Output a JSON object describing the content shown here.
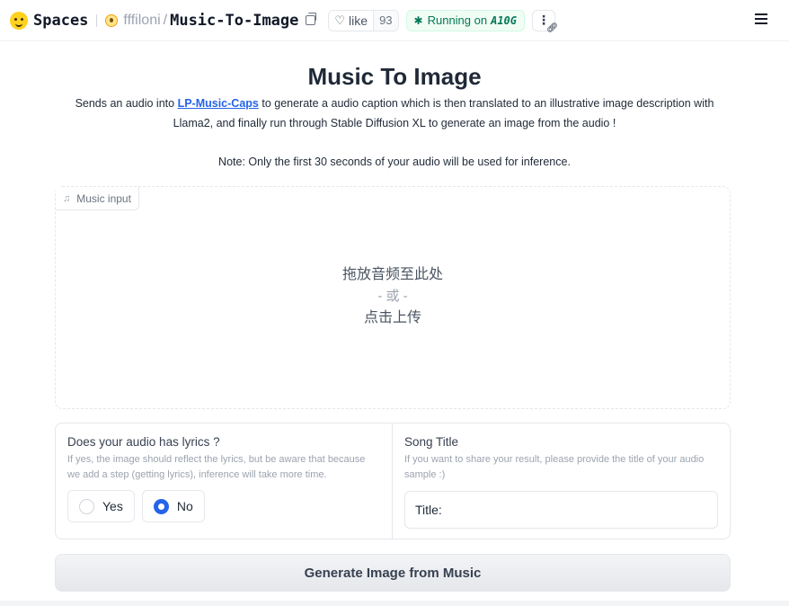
{
  "header": {
    "spaces_label": "Spaces",
    "owner": "fffiloni",
    "slash": "/",
    "repo": "Music-To-Image",
    "like_label": "like",
    "like_count": "93",
    "status_prefix": "Running on",
    "status_hardware": "A10G",
    "more_label": "⋮",
    "icons": {
      "logo": "hugging-face-logo",
      "copy": "copy-icon",
      "heart": "heart-icon",
      "status": "fan-icon",
      "link": "link-icon",
      "menu": "hamburger-menu-icon"
    },
    "colors": {
      "status_text": "#047857",
      "status_bg": "#f0fdf4"
    }
  },
  "main": {
    "title": "Music To Image",
    "desc_prefix": "Sends an audio into",
    "desc_link": "LP-Music-Caps",
    "desc_suffix": "to generate a audio caption which is then translated to an illustrative image description with Llama2, and finally run through Stable Diffusion XL to generate an image from the audio !",
    "note": "Note: Only the first 30 seconds of your audio will be used for inference.",
    "colors": {
      "link": "#2563eb",
      "radio_checked": "#2563eb"
    }
  },
  "dropzone": {
    "label": "Music input",
    "line1": "拖放音频至此处",
    "line2": "- 或 -",
    "line3": "点击上传"
  },
  "lyrics": {
    "title": "Does your audio has lyrics ?",
    "info": "If yes, the image should reflect the lyrics, but be aware that because we add a step (getting lyrics), inference will take more time.",
    "options": [
      "Yes",
      "No"
    ],
    "selected": "No"
  },
  "song": {
    "title": "Song Title",
    "info": "If you want to share your result, please provide the title of your audio sample :)",
    "placeholder": "Title:",
    "value": ""
  },
  "actions": {
    "generate_label": "Generate Image from Music"
  }
}
